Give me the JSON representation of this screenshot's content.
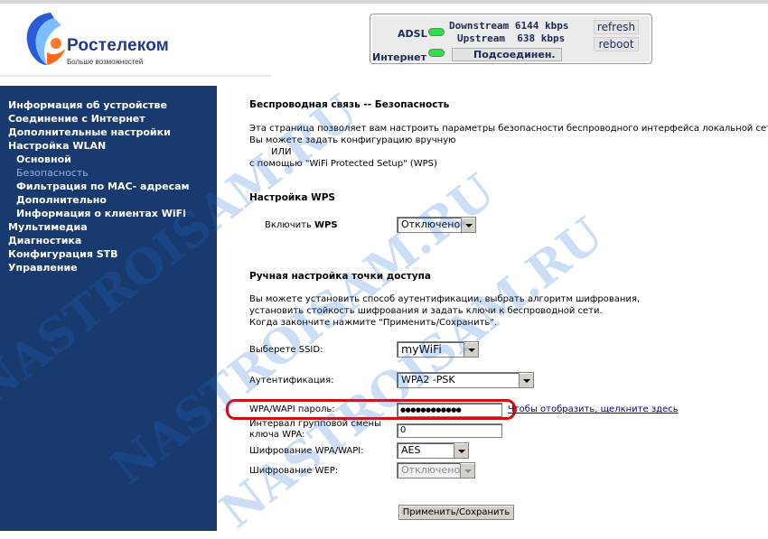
{
  "brand": {
    "name": "Ростелеком",
    "tagline": "Больше возможностей"
  },
  "status": {
    "adsl_label": "ADSL",
    "downstream": "Downstream 6144 kbps",
    "upstream": "Upstream  638 kbps",
    "internet_label": "Интернет",
    "connection": "Подсоединен.",
    "refresh_label": "refresh",
    "reboot_label": "reboot",
    "led_color": "#2ee04a"
  },
  "sidebar": {
    "items": [
      {
        "label": "Информация об устройстве"
      },
      {
        "label": "Соединение с Интернет"
      },
      {
        "label": "Дополнительные настройки"
      },
      {
        "label": "Настройка WLAN"
      },
      {
        "label": "Основной"
      },
      {
        "label": "Безопасность"
      },
      {
        "label": "Фильтрация по МАС- адресам"
      },
      {
        "label": "Дополнительно"
      },
      {
        "label": "Информация о клиентах WiFi"
      },
      {
        "label": "Мультимедиа"
      },
      {
        "label": "Диагностика"
      },
      {
        "label": "Конфигурация STB"
      },
      {
        "label": "Управление"
      }
    ]
  },
  "page": {
    "title": "Беспроводная связь -- Безопасность",
    "intro_line1": "Эта страница позволяет вам настроить параметры безопасности беспроводного интерфейса локальной сети.",
    "intro_line2": "Вы можете задать конфигурацию вручную",
    "intro_or": "ИЛИ",
    "intro_line3": "с помощью \"WiFi Protected Setup\" (WPS)"
  },
  "wps": {
    "title": "Настройка WPS",
    "enable_label_prefix": "Включить ",
    "enable_label_bold": "WPS",
    "enable_value": "Отключено"
  },
  "manual": {
    "title": "Ручная настройка точки доступа",
    "desc_line1": "Вы можете установить способ аутентификации, выбрать алгоритм шифрования,",
    "desc_line2": "установить стойкость шифрования и задать ключи к беспроводной сети.",
    "desc_line3": "Когда закончите нажмите \"Применить/Сохранить\".",
    "ssid_label": "Выберете SSID:",
    "ssid_value": "myWiFi",
    "auth_label": "Аутентификация:",
    "auth_value": "WPA2 -PSK",
    "password_label": "WPA/WAPI пароль:",
    "password_value": "●●●●●●●●●●●●",
    "show_link": "Чтобы отобразить, щелкните здесь",
    "interval_label_line1": "Интервал групповой смены",
    "interval_label_line2": "ключа WPA:",
    "interval_value": "0",
    "wpa_enc_label": "Шифрование WPA/WAPI:",
    "wpa_enc_value": "AES",
    "wep_label": "Шифрование WEP:",
    "wep_value": "Отключено",
    "apply_label": "Применить/Сохранить"
  },
  "watermark": {
    "text": "NASTROISAM.RU"
  },
  "colors": {
    "sidebar_bg": "#193a6e",
    "sidebar_active": "#8fb2e0",
    "highlight": "#d01010",
    "watermark": "#1e6fd6"
  }
}
